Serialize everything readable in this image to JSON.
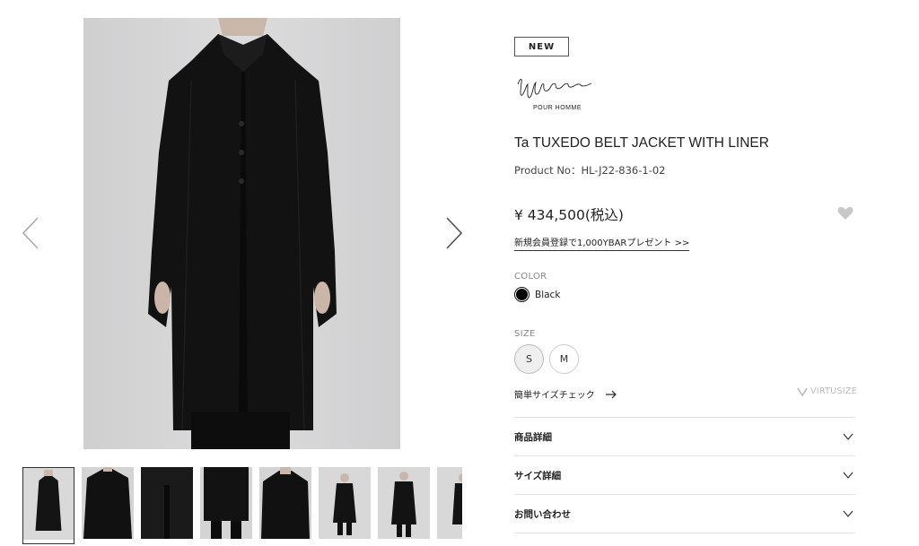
{
  "gallery": {
    "prev_icon": "chevron-left-icon",
    "next_icon": "chevron-right-icon",
    "thumbnail_count": 8,
    "active_thumbnail": 1
  },
  "product": {
    "badge": "NEW",
    "brand_sub": "POUR HOMME",
    "name": "Ta TUXEDO BELT JACKET WITH LINER",
    "product_no": "Product No：HL-J22-836-1-02",
    "price": "¥ 434,500(税込)",
    "promo": "新規会員登録で1,000YBARプレゼント >>",
    "favorite_icon": "heart-icon"
  },
  "color": {
    "label": "COLOR",
    "selected": "Black",
    "swatch_hex": "#000000"
  },
  "size": {
    "label": "SIZE",
    "options": [
      "S",
      "M"
    ],
    "selected": "S",
    "size_check": "簡単サイズチェック",
    "virtusize": "VIRTUSIZE"
  },
  "accordions": [
    {
      "label": "商品詳細"
    },
    {
      "label": "サイズ詳細"
    },
    {
      "label": "お問い合わせ"
    }
  ]
}
